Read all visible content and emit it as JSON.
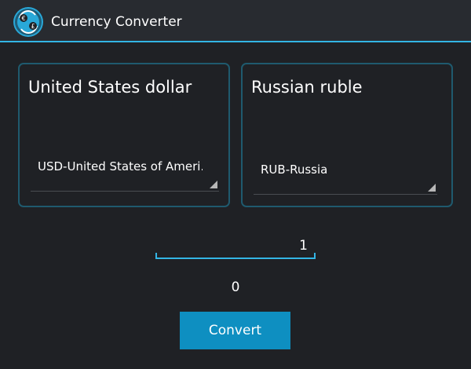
{
  "app": {
    "title": "Currency Converter",
    "icon": "currency-exchange-icon"
  },
  "from": {
    "title": "United States dollar",
    "selected": "USD-United States of Ameri.."
  },
  "to": {
    "title": "Russian ruble",
    "selected": "RUB-Russia"
  },
  "amount": {
    "value": "1"
  },
  "result": {
    "value": "0"
  },
  "actions": {
    "convert_label": "Convert"
  },
  "colors": {
    "accent": "#33b5e5",
    "button": "#0e8fc1",
    "card_border": "#1f5a6e",
    "background": "#1f2125"
  }
}
